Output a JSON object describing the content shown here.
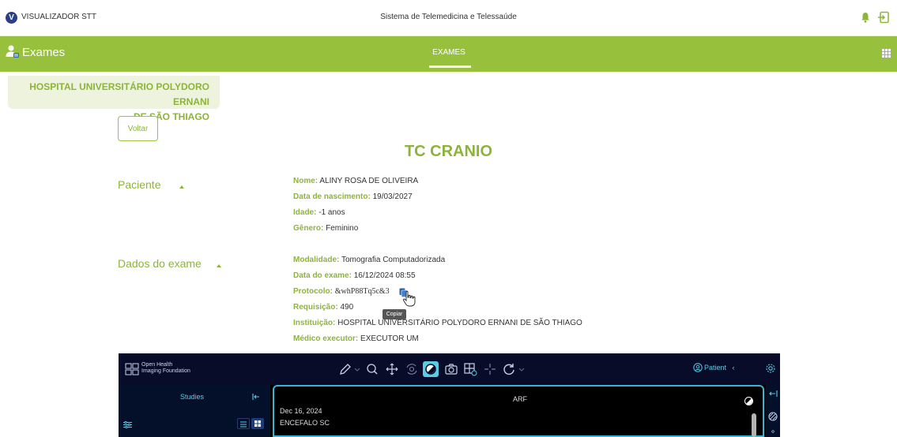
{
  "topbar": {
    "logo_letter": "V",
    "app_name": "VISUALIZADOR STT",
    "system_title": "Sistema de Telemedicina e Telessaúde"
  },
  "navbar": {
    "module_title": "Exames",
    "tab_label": "EXAMES"
  },
  "hospital": {
    "line1": "HOSPITAL UNIVERSITÁRIO POLYDORO ERNANI",
    "line2": "DE SÃO THIAGO"
  },
  "back_button": "Voltar",
  "exam_title": "TC CRANIO",
  "patient_section": {
    "heading": "Paciente",
    "fields": [
      {
        "label": "Nome:",
        "value": "ALINY ROSA DE OLIVEIRA"
      },
      {
        "label": "Data de nascimento:",
        "value": "19/03/2027"
      },
      {
        "label": "Idade:",
        "value": "-1 anos"
      },
      {
        "label": "Gênero:",
        "value": "Feminino"
      }
    ]
  },
  "exam_section": {
    "heading": "Dados do exame",
    "fields": [
      {
        "label": "Modalidade:",
        "value": "Tomografia Computadorizada"
      },
      {
        "label": "Data do exame:",
        "value": "16/12/2024 08:55"
      },
      {
        "label": "Protocolo:",
        "value": "&whP88Tq5c&3"
      },
      {
        "label": "Requisição:",
        "value": "490"
      },
      {
        "label": "Instituição:",
        "value": "HOSPITAL UNIVERSITÁRIO POLYDORO ERNANI DE SÃO THIAGO"
      },
      {
        "label": "Médico executor:",
        "value": "EXECUTOR UM"
      }
    ]
  },
  "copy_tooltip": "Copiar",
  "viewer": {
    "brand_line1": "Open Health",
    "brand_line2": "Imaging Foundation",
    "patient_label": "Patient",
    "studies_label": "Studies",
    "viewport_title": "ARF",
    "study_date": "Dec 16, 2024",
    "study_description": "ENCEFALO SC",
    "accent_color": "#5acce6"
  },
  "colors": {
    "brand_green": "#97c13d",
    "label_green": "#8db43a",
    "logo_blue": "#2a3e8c"
  },
  "icons": [
    "bell-icon",
    "logout-icon",
    "user-group-icon",
    "apps-grid-icon",
    "copy-icon",
    "pointer-hand-icon",
    "pencil-icon",
    "zoom-icon",
    "pan-icon",
    "rotate-icon",
    "contrast-icon",
    "camera-icon",
    "layout-icon",
    "crosshair-icon",
    "reset-icon",
    "settings-icon"
  ]
}
